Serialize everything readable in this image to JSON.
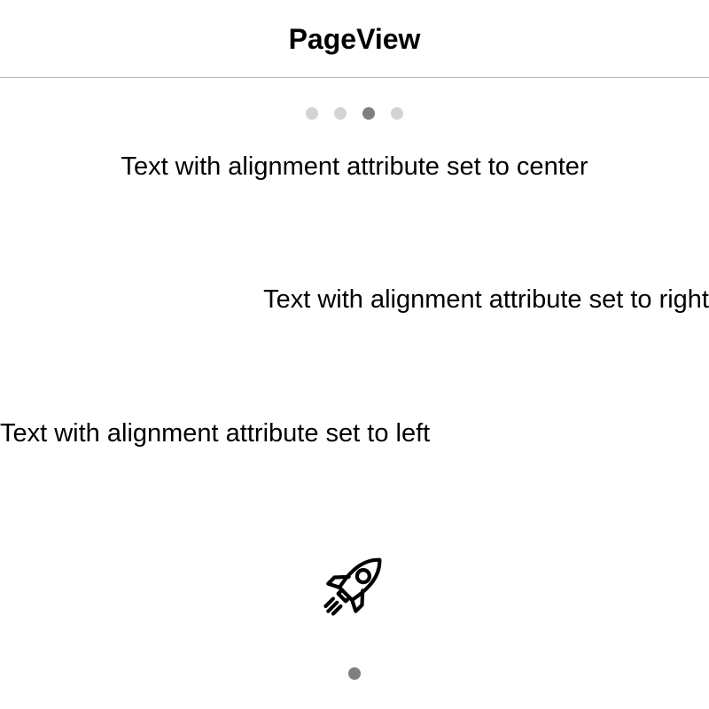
{
  "navbar": {
    "title": "PageView"
  },
  "pager": {
    "pages": 4,
    "current_index": 2,
    "dot_color": "#d3d3d3",
    "active_dot_color": "#7f7f7f"
  },
  "content": {
    "text_center": "Text with alignment attribute set to center",
    "text_right": "Text with alignment attribute set to right",
    "text_left": "Text with alignment attribute set to left",
    "icon": "rocket-icon"
  },
  "bottom_indicator": {
    "color": "#7f7f7f"
  }
}
